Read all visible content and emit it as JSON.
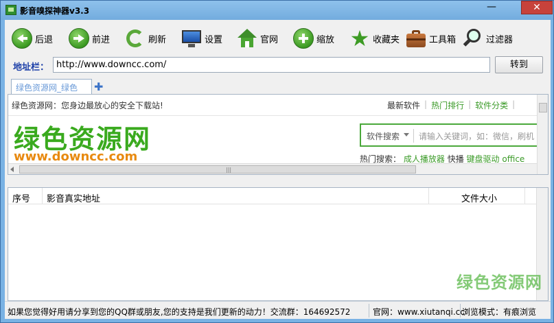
{
  "window": {
    "title": "影音嗅探神器v3.3",
    "minimize_glyph": "—",
    "close_glyph": "✕"
  },
  "toolbar": {
    "buttons": [
      {
        "label": "后退",
        "icon": "back-icon"
      },
      {
        "label": "前进",
        "icon": "forward-icon"
      },
      {
        "label": "刷新",
        "icon": "refresh-icon"
      },
      {
        "label": "设置",
        "icon": "monitor-icon"
      },
      {
        "label": "官网",
        "icon": "home-icon"
      },
      {
        "label": "缩放",
        "icon": "zoom-plus-icon"
      },
      {
        "label": "收藏夹",
        "icon": "star-icon"
      },
      {
        "label": "工具箱",
        "icon": "toolbox-icon"
      },
      {
        "label": "过滤器",
        "icon": "magnifier-icon"
      }
    ]
  },
  "address": {
    "label": "地址栏：",
    "value": "http://www.downcc.com/",
    "go_label": "转到"
  },
  "tabs": [
    {
      "label": "绿色资源网_绿色",
      "active": true
    }
  ],
  "tab_add_glyph": "✚",
  "webpage": {
    "tagline": "绿色资源网：您身边最放心的安全下载站!",
    "nav_links": [
      "最新软件",
      "热门排行",
      "软件分类"
    ],
    "logo_text": "绿色资源网",
    "logo_url": "www.downcc.com",
    "search_category": "软件搜索",
    "search_placeholder": "请输入关键词，如：微信，刷机",
    "hot_label": "热门搜索：",
    "hot_items": [
      "成人播放器",
      "快播",
      "键盘驱动",
      "office"
    ],
    "grip_glyph": "|||"
  },
  "list": {
    "columns": [
      "序号",
      "影音真实地址",
      "文件大小"
    ],
    "rows": []
  },
  "status": {
    "message": "如果您觉得好用请分享到您的QQ群或朋友,您的支持是我们更新的动力！交流群：164692572",
    "website": "官网：www.xiutanqi.cc",
    "mode": "浏览模式：有痕浏览"
  },
  "watermark": "绿色资源网",
  "colors": {
    "titlebar": "#79b2e4",
    "accent_green": "#3aaa1e",
    "logo_orange": "#e88a10",
    "close_red": "#c7423b"
  }
}
